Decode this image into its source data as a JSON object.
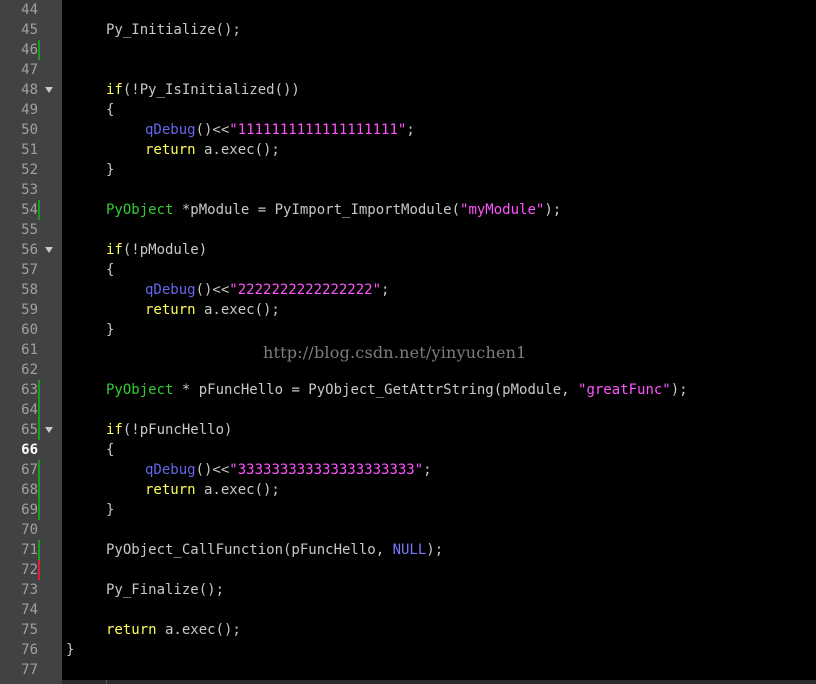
{
  "editor": {
    "current_line": 66,
    "watermark": "http://blog.csdn.net/yinyuchen1",
    "colors": {
      "background": "#000000",
      "gutter": "#404244",
      "keyword": "#ffff55",
      "type": "#33cc33",
      "function": "#6666ee",
      "string": "#ff55ff",
      "modified_marker": "#1f9a1f",
      "error_marker": "#e0202a"
    },
    "lines": [
      {
        "num": 44,
        "marker": "",
        "fold": false,
        "indent": 0,
        "tokens": []
      },
      {
        "num": 45,
        "marker": "",
        "fold": false,
        "indent": 1,
        "tokens": [
          {
            "t": "Py_Initialize();",
            "c": "plain"
          }
        ]
      },
      {
        "num": 46,
        "marker": "green",
        "fold": false,
        "indent": 0,
        "tokens": []
      },
      {
        "num": 47,
        "marker": "",
        "fold": false,
        "indent": 0,
        "tokens": []
      },
      {
        "num": 48,
        "marker": "",
        "fold": true,
        "indent": 1,
        "tokens": [
          {
            "t": "if",
            "c": "kw"
          },
          {
            "t": "(!Py_IsInitialized())",
            "c": "plain"
          }
        ]
      },
      {
        "num": 49,
        "marker": "",
        "fold": false,
        "indent": 1,
        "tokens": [
          {
            "t": "{",
            "c": "plain"
          }
        ]
      },
      {
        "num": 50,
        "marker": "",
        "fold": false,
        "indent": 2,
        "tokens": [
          {
            "t": "qDebug",
            "c": "fn"
          },
          {
            "t": "()<<",
            "c": "plain"
          },
          {
            "t": "\"1111111111111111111\"",
            "c": "str"
          },
          {
            "t": ";",
            "c": "plain"
          }
        ]
      },
      {
        "num": 51,
        "marker": "",
        "fold": false,
        "indent": 2,
        "tokens": [
          {
            "t": "return",
            "c": "kw"
          },
          {
            "t": " a.exec();",
            "c": "plain"
          }
        ]
      },
      {
        "num": 52,
        "marker": "",
        "fold": false,
        "indent": 1,
        "tokens": [
          {
            "t": "}",
            "c": "plain"
          }
        ]
      },
      {
        "num": 53,
        "marker": "",
        "fold": false,
        "indent": 0,
        "tokens": []
      },
      {
        "num": 54,
        "marker": "green",
        "fold": false,
        "indent": 1,
        "tokens": [
          {
            "t": "PyObject",
            "c": "ty"
          },
          {
            "t": " *pModule = PyImport_ImportModule(",
            "c": "plain"
          },
          {
            "t": "\"myModule\"",
            "c": "str"
          },
          {
            "t": ");",
            "c": "plain"
          }
        ]
      },
      {
        "num": 55,
        "marker": "",
        "fold": false,
        "indent": 0,
        "tokens": []
      },
      {
        "num": 56,
        "marker": "",
        "fold": true,
        "indent": 1,
        "tokens": [
          {
            "t": "if",
            "c": "kw"
          },
          {
            "t": "(!pModule)",
            "c": "plain"
          }
        ]
      },
      {
        "num": 57,
        "marker": "",
        "fold": false,
        "indent": 1,
        "tokens": [
          {
            "t": "{",
            "c": "plain"
          }
        ]
      },
      {
        "num": 58,
        "marker": "",
        "fold": false,
        "indent": 2,
        "tokens": [
          {
            "t": "qDebug",
            "c": "fn"
          },
          {
            "t": "()<<",
            "c": "plain"
          },
          {
            "t": "\"2222222222222222\"",
            "c": "str"
          },
          {
            "t": ";",
            "c": "plain"
          }
        ]
      },
      {
        "num": 59,
        "marker": "",
        "fold": false,
        "indent": 2,
        "tokens": [
          {
            "t": "return",
            "c": "kw"
          },
          {
            "t": " a.exec();",
            "c": "plain"
          }
        ]
      },
      {
        "num": 60,
        "marker": "",
        "fold": false,
        "indent": 1,
        "tokens": [
          {
            "t": "}",
            "c": "plain"
          }
        ]
      },
      {
        "num": 61,
        "marker": "",
        "fold": false,
        "indent": 0,
        "tokens": []
      },
      {
        "num": 62,
        "marker": "",
        "fold": false,
        "indent": 0,
        "tokens": []
      },
      {
        "num": 63,
        "marker": "green",
        "fold": false,
        "indent": 1,
        "tokens": [
          {
            "t": "PyObject",
            "c": "ty"
          },
          {
            "t": " * pFuncHello = PyObject_GetAttrString(pModule, ",
            "c": "plain"
          },
          {
            "t": "\"greatFunc\"",
            "c": "str"
          },
          {
            "t": ");",
            "c": "plain"
          }
        ]
      },
      {
        "num": 64,
        "marker": "green",
        "fold": false,
        "indent": 0,
        "tokens": []
      },
      {
        "num": 65,
        "marker": "green",
        "fold": true,
        "indent": 1,
        "tokens": [
          {
            "t": "if",
            "c": "kw"
          },
          {
            "t": "(!pFuncHello)",
            "c": "plain"
          }
        ]
      },
      {
        "num": 66,
        "marker": "",
        "fold": false,
        "indent": 1,
        "tokens": [
          {
            "t": "{",
            "c": "plain"
          }
        ]
      },
      {
        "num": 67,
        "marker": "green",
        "fold": false,
        "indent": 2,
        "tokens": [
          {
            "t": "qDebug",
            "c": "fn"
          },
          {
            "t": "()<<",
            "c": "plain"
          },
          {
            "t": "\"333333333333333333333\"",
            "c": "str"
          },
          {
            "t": ";",
            "c": "plain"
          }
        ]
      },
      {
        "num": 68,
        "marker": "green",
        "fold": false,
        "indent": 2,
        "tokens": [
          {
            "t": "return",
            "c": "kw"
          },
          {
            "t": " a.exec();",
            "c": "plain"
          }
        ]
      },
      {
        "num": 69,
        "marker": "green",
        "fold": false,
        "indent": 1,
        "tokens": [
          {
            "t": "}",
            "c": "plain"
          }
        ]
      },
      {
        "num": 70,
        "marker": "",
        "fold": false,
        "indent": 0,
        "tokens": []
      },
      {
        "num": 71,
        "marker": "green",
        "fold": false,
        "indent": 1,
        "tokens": [
          {
            "t": "PyObject_CallFunction(pFuncHello, ",
            "c": "plain"
          },
          {
            "t": "NULL",
            "c": "nul"
          },
          {
            "t": ");",
            "c": "plain"
          }
        ]
      },
      {
        "num": 72,
        "marker": "red",
        "fold": false,
        "indent": 0,
        "tokens": []
      },
      {
        "num": 73,
        "marker": "",
        "fold": false,
        "indent": 1,
        "tokens": [
          {
            "t": "Py_Finalize();",
            "c": "plain"
          }
        ]
      },
      {
        "num": 74,
        "marker": "",
        "fold": false,
        "indent": 0,
        "tokens": []
      },
      {
        "num": 75,
        "marker": "",
        "fold": false,
        "indent": 1,
        "tokens": [
          {
            "t": "return",
            "c": "kw"
          },
          {
            "t": " a.exec();",
            "c": "plain"
          }
        ]
      },
      {
        "num": 76,
        "marker": "",
        "fold": false,
        "indent": 0,
        "tokens": [
          {
            "t": "}",
            "c": "plain"
          }
        ]
      },
      {
        "num": 77,
        "marker": "",
        "fold": false,
        "indent": 0,
        "tokens": []
      }
    ]
  }
}
